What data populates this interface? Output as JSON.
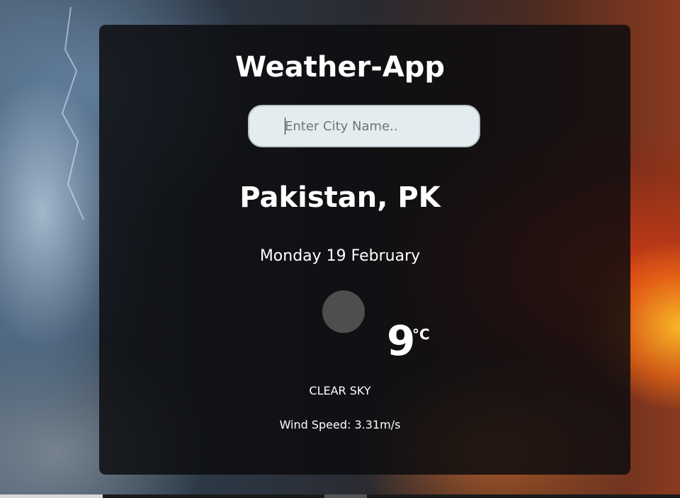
{
  "app": {
    "title": "Weather-App"
  },
  "search": {
    "placeholder": "Enter City Name..",
    "value": ""
  },
  "weather": {
    "location": "Pakistan, PK",
    "date": "Monday 19 February",
    "temperature": "9",
    "unit": "°C",
    "condition": "CLEAR SKY",
    "wind": "Wind Speed: 3.31m/s",
    "icon": "weather-icon-placeholder"
  },
  "colors": {
    "card_background": "#0c0c0e",
    "search_background": "#e3edf0",
    "text": "#ffffff",
    "icon_placeholder": "#4e4e4e"
  }
}
